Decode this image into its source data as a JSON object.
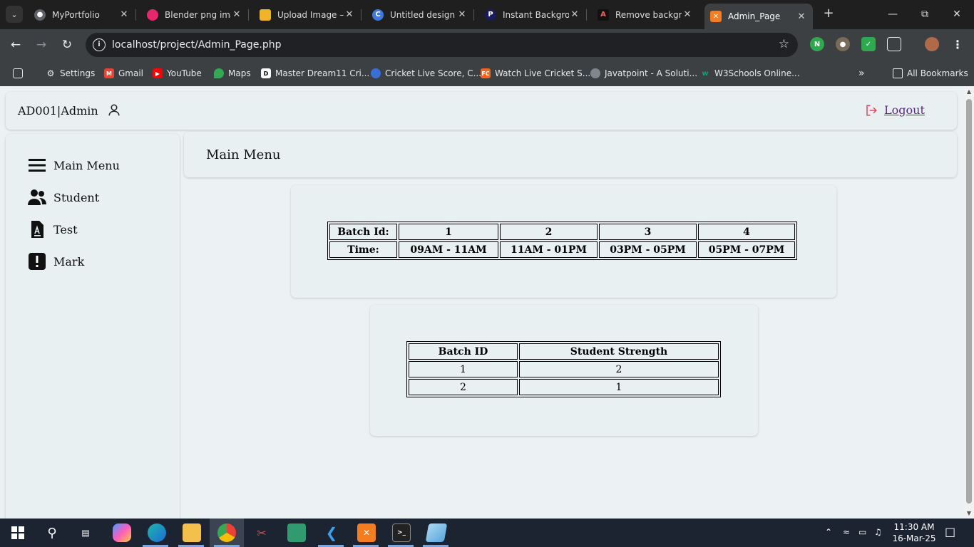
{
  "browser": {
    "tabs": [
      {
        "title": "MyPortfolio",
        "favicon": "globe-icon"
      },
      {
        "title": "Blender png ima",
        "favicon": "blender-icon"
      },
      {
        "title": "Upload Image –",
        "favicon": "upload-icon"
      },
      {
        "title": "Untitled design",
        "favicon": "canva-icon"
      },
      {
        "title": "Instant Backgrou",
        "favicon": "photoroom-icon"
      },
      {
        "title": "Remove backgro",
        "favicon": "remove-bg-icon"
      },
      {
        "title": "Admin_Page",
        "favicon": "xampp-icon",
        "active": true
      }
    ],
    "url": "localhost/project/Admin_Page.php",
    "bookmarks": [
      {
        "label": "Settings",
        "icon": "gear-icon"
      },
      {
        "label": "Gmail",
        "icon": "gmail-icon"
      },
      {
        "label": "YouTube",
        "icon": "youtube-icon"
      },
      {
        "label": "Maps",
        "icon": "maps-icon"
      },
      {
        "label": "Master Dream11 Cri...",
        "icon": "dream11-icon"
      },
      {
        "label": "Cricket Live Score, C...",
        "icon": "cricket-icon"
      },
      {
        "label": "Watch Live Cricket S...",
        "icon": "fc-icon"
      },
      {
        "label": "Javatpoint - A Soluti...",
        "icon": "globe-icon"
      },
      {
        "label": "W3Schools Online...",
        "icon": "w3schools-icon"
      }
    ],
    "all_bookmarks": "All Bookmarks"
  },
  "header": {
    "user_id": "AD001|Admin",
    "logout_label": "Logout"
  },
  "sidebar": {
    "items": [
      {
        "label": "Main Menu",
        "icon": "hamburger-icon"
      },
      {
        "label": "Student",
        "icon": "users-icon"
      },
      {
        "label": "Test",
        "icon": "test-file-icon"
      },
      {
        "label": "Mark",
        "icon": "exclamation-icon"
      }
    ]
  },
  "main": {
    "title": "Main Menu",
    "batch_table": {
      "row_labels": [
        "Batch Id:",
        "Time:"
      ],
      "batch_ids": [
        "1",
        "2",
        "3",
        "4"
      ],
      "times": [
        "09AM - 11AM",
        "11AM - 01PM",
        "03PM - 05PM",
        "05PM - 07PM"
      ]
    },
    "strength_table": {
      "headers": [
        "Batch ID",
        "Student Strength"
      ],
      "rows": [
        [
          "1",
          "2"
        ],
        [
          "2",
          "1"
        ]
      ]
    }
  },
  "taskbar": {
    "time": "11:30 AM",
    "date": "16-Mar-25"
  }
}
